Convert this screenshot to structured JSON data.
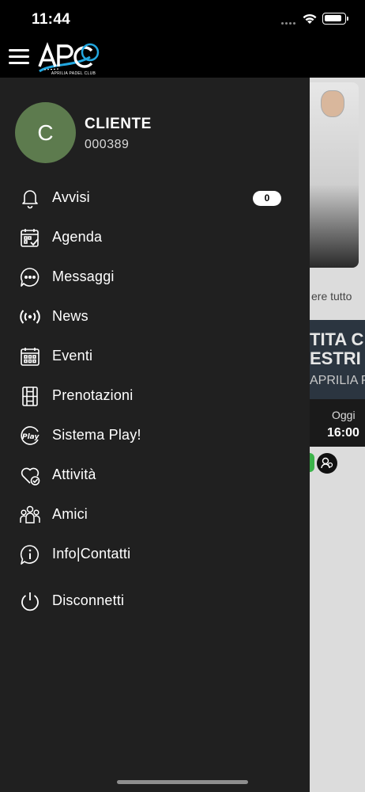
{
  "status_bar": {
    "time": "11:44"
  },
  "header": {
    "logo_text": "APC",
    "logo_subtitle": "APRILIA PADEL CLUB"
  },
  "user": {
    "initial": "C",
    "name": "CLIENTE",
    "code": "000389"
  },
  "menu": {
    "items": [
      {
        "label": "Avvisi",
        "icon": "bell-icon",
        "badge": "0"
      },
      {
        "label": "Agenda",
        "icon": "calendar-check-icon"
      },
      {
        "label": "Messaggi",
        "icon": "chat-bubble-icon"
      },
      {
        "label": "News",
        "icon": "broadcast-icon"
      },
      {
        "label": "Eventi",
        "icon": "calendar-grid-icon"
      },
      {
        "label": "Prenotazioni",
        "icon": "court-icon"
      },
      {
        "label": "Sistema Play!",
        "icon": "play-badge-icon"
      },
      {
        "label": "Attività",
        "icon": "heart-check-icon"
      },
      {
        "label": "Amici",
        "icon": "people-icon"
      },
      {
        "label": "Info|Contatti",
        "icon": "info-bubble-icon"
      },
      {
        "label": "Disconnetti",
        "icon": "power-icon"
      }
    ]
  },
  "background": {
    "see_all": "ere tutto",
    "banner_line1": "TITA C",
    "banner_line2": "ESTRI",
    "banner_line3": "APRILIA P",
    "slot_day": "Oggi",
    "slot_time": "16:00"
  },
  "colors": {
    "avatar": "#5d7b4e",
    "drawer": "#202020",
    "accent_logo": "#22a7e0"
  }
}
